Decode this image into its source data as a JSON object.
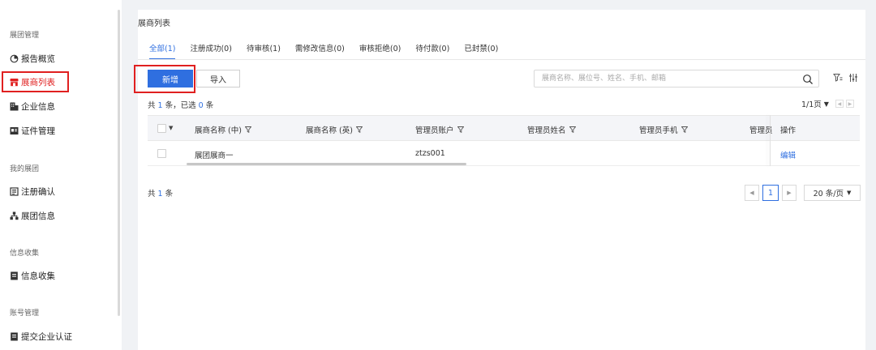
{
  "sidebar": {
    "groups": [
      {
        "title": "展团管理",
        "items": [
          {
            "label": "报告概览",
            "icon": "chart-pie-icon"
          },
          {
            "label": "展商列表",
            "icon": "store-icon",
            "active": true
          },
          {
            "label": "企业信息",
            "icon": "building-icon"
          },
          {
            "label": "证件管理",
            "icon": "id-card-icon"
          }
        ]
      },
      {
        "title": "我的展团",
        "items": [
          {
            "label": "注册确认",
            "icon": "register-icon"
          },
          {
            "label": "展团信息",
            "icon": "org-icon"
          }
        ]
      },
      {
        "title": "信息收集",
        "items": [
          {
            "label": "信息收集",
            "icon": "doc-icon"
          }
        ]
      },
      {
        "title": "账号管理",
        "items": [
          {
            "label": "提交企业认证",
            "icon": "doc-icon"
          }
        ]
      }
    ]
  },
  "main": {
    "title": "展商列表",
    "tabs": [
      {
        "label": "全部(1)",
        "active": true
      },
      {
        "label": "注册成功(0)"
      },
      {
        "label": "待审核(1)"
      },
      {
        "label": "需修改信息(0)"
      },
      {
        "label": "审核拒绝(0)"
      },
      {
        "label": "待付款(0)"
      },
      {
        "label": "已封禁(0)"
      }
    ],
    "toolbar": {
      "new_label": "新增",
      "import_label": "导入",
      "search_placeholder": "展商名称、展位号、姓名、手机、邮箱"
    },
    "summary": {
      "prefix": "共",
      "count": "1",
      "mid": "条，已选",
      "selected": "0",
      "suffix": "条"
    },
    "pager_top": "1/1页",
    "table": {
      "columns": [
        "展商名称 (中)",
        "展商名称 (英)",
        "管理员账户",
        "管理员姓名",
        "管理员手机",
        "管理员",
        "操作"
      ],
      "rows": [
        {
          "name_cn": "展团展商一",
          "name_en": "",
          "account": "ztzs001",
          "admin_name": "",
          "admin_phone": "",
          "admin_extra": "",
          "action": "编辑"
        }
      ]
    },
    "footer": {
      "total_prefix": "共",
      "total_count": "1",
      "total_suffix": "条",
      "current_page": "1",
      "page_size": "20 条/页"
    }
  },
  "colors": {
    "accent": "#2f6fe0",
    "highlight": "#e02020",
    "background": "#f0f2f5"
  }
}
